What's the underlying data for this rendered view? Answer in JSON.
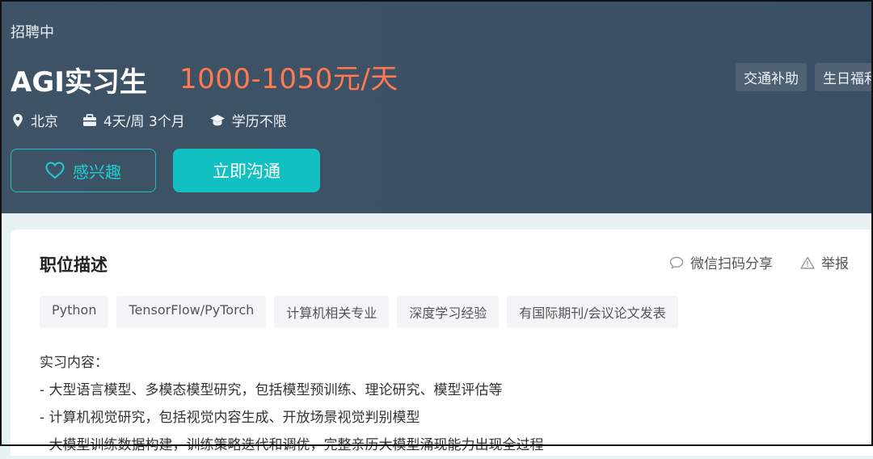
{
  "header": {
    "status": "招聘中",
    "title": "AGI实习生",
    "salary": "1000-1050元/天",
    "benefits": [
      "交通补助",
      "生日福利"
    ],
    "location": "北京",
    "schedule": "4天/周 3个月",
    "education": "学历不限",
    "interest_label": "感兴趣",
    "chat_label": "立即沟通"
  },
  "section": {
    "title": "职位描述",
    "share_label": "微信扫码分享",
    "report_label": "举报",
    "tags": [
      "Python",
      "TensorFlow/PyTorch",
      "计算机相关专业",
      "深度学习经验",
      "有国际期刊/会议论文发表"
    ],
    "description": [
      "实习内容：",
      "- 大型语言模型、多模态模型研究，包括模型预训练、理论研究、模型评估等",
      "- 计算机视觉研究，包括视觉内容生成、开放场景视觉判别模型",
      "- 大模型训练数据构建，训练策略迭代和调优，完整亲历大模型涌现能力出现全过程"
    ]
  },
  "colors": {
    "header_bg": "#3f5367",
    "salary": "#ff7a50",
    "accent": "#12c0c1"
  },
  "icons": [
    "location-pin-icon",
    "briefcase-icon",
    "graduation-cap-icon",
    "heart-icon",
    "chat-bubble-icon",
    "warning-icon"
  ]
}
